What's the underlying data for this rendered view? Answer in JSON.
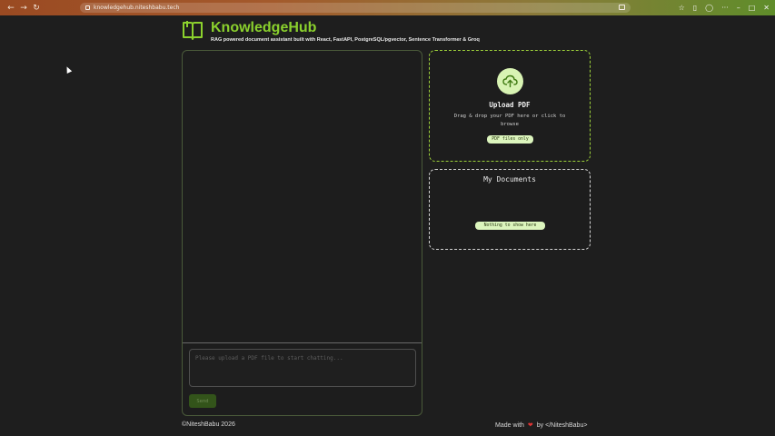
{
  "browser": {
    "back_icon": "back-arrow-icon",
    "forward_icon": "forward-arrow-icon",
    "reload_icon": "reload-icon",
    "url": "knowledgehub.niteshbabu.tech",
    "more_label": "···"
  },
  "header": {
    "title": "KnowledgeHub",
    "subtitle": "RAG powered document assistant built with React, FastAPI, PostgreSQL/pgvector, Sentence Transformer & Groq",
    "accent_color": "#8bd12d"
  },
  "chat": {
    "input_placeholder": "Please upload a PDF file to start chatting...",
    "send_label": "Send"
  },
  "upload": {
    "title": "Upload PDF",
    "description": "Drag & drop your PDF here or click to browse",
    "badge": "PDF files only",
    "icon": "cloud-upload-icon"
  },
  "documents": {
    "title": "My Documents",
    "empty_label": "Nothing to show here"
  },
  "footer": {
    "copyright": "©NiteshBabu 2026",
    "made_with": "Made with",
    "by": "by </NiteshBabu>"
  }
}
